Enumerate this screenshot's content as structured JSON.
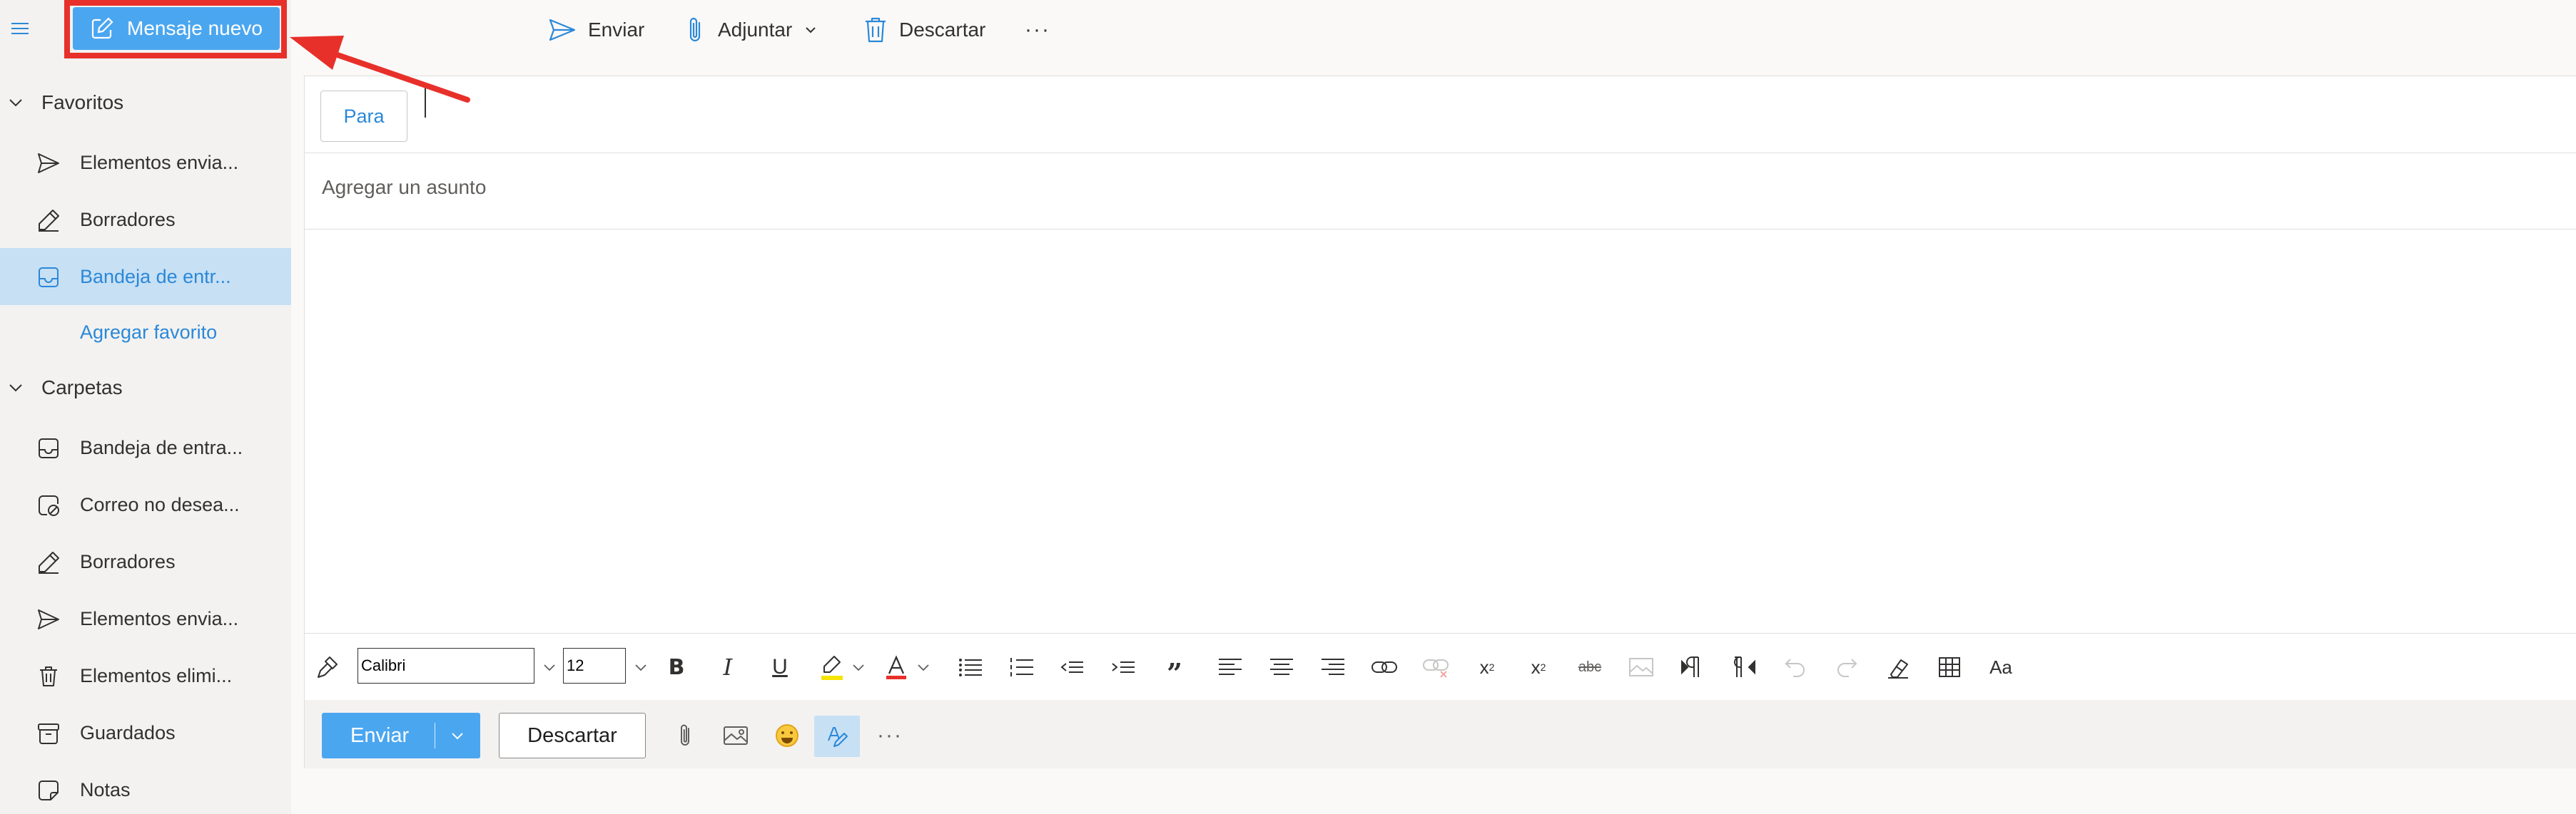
{
  "sidebar": {
    "new_message_label": "Mensaje nuevo",
    "favorites": {
      "title": "Favoritos",
      "items": [
        {
          "label": "Elementos envia...",
          "icon": "send-icon"
        },
        {
          "label": "Borradores",
          "icon": "pencil-icon"
        },
        {
          "label": "Bandeja de entr...",
          "icon": "inbox-icon",
          "active": true
        }
      ],
      "add_favorite": "Agregar favorito"
    },
    "folders": {
      "title": "Carpetas",
      "items": [
        {
          "label": "Bandeja de entra...",
          "icon": "inbox-icon"
        },
        {
          "label": "Correo no desea...",
          "icon": "junk-icon"
        },
        {
          "label": "Borradores",
          "icon": "pencil-icon"
        },
        {
          "label": "Elementos envia...",
          "icon": "send-icon"
        },
        {
          "label": "Elementos elimi...",
          "icon": "trash-icon"
        },
        {
          "label": "Guardados",
          "icon": "archive-icon"
        },
        {
          "label": "Notas",
          "icon": "note-icon"
        }
      ]
    }
  },
  "commandbar": {
    "send": "Enviar",
    "attach": "Adjuntar",
    "discard": "Descartar",
    "more": "···"
  },
  "compose": {
    "to_button": "Para",
    "to_value": "",
    "subject_placeholder": "Agregar un asunto",
    "body": ""
  },
  "format": {
    "font_name": "Calibri",
    "font_size": "12",
    "highlight_color": "#f5e400",
    "font_color": "#e8302a"
  },
  "actions": {
    "send": "Enviar",
    "discard": "Descartar",
    "more": "···"
  },
  "colors": {
    "accent": "#4ba6f0",
    "link": "#2b88d8",
    "annotation": "#e8302a"
  }
}
